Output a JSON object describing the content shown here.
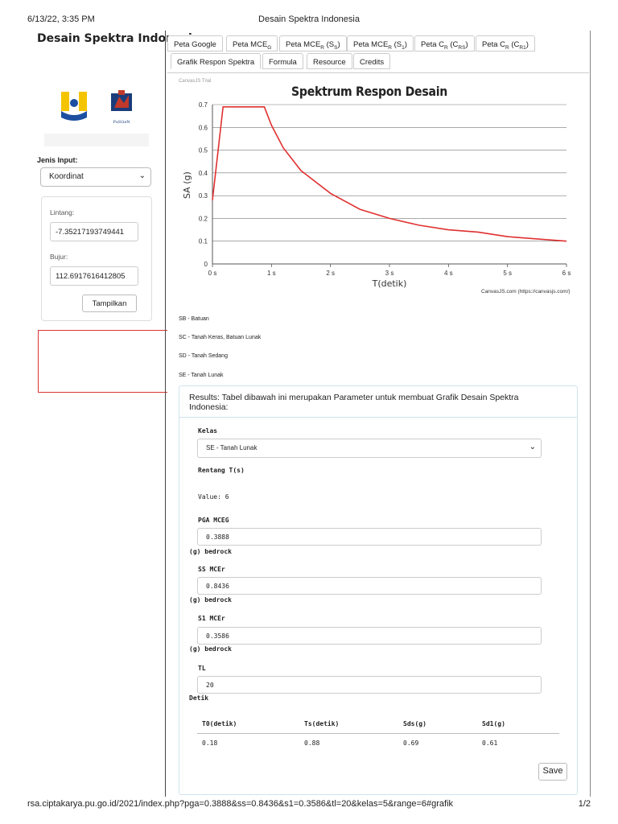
{
  "print": {
    "date": "6/13/22, 3:35 PM",
    "title": "Desain Spektra Indonesia",
    "url": "rsa.ciptakarya.pu.go.id/2021/index.php?pga=0.3888&ss=0.8436&s1=0.3586&tl=20&kelas=5&range=6#grafik",
    "page": "1/2"
  },
  "sidebar": {
    "title": "Desain Spektra Indonesia",
    "logo_pu": "pu-logo",
    "logo_pusgen": "PuSGeN",
    "jenis_label": "Jenis Input:",
    "jenis_value": "Koordinat",
    "lintang_label": "Lintang:",
    "lintang_value": "-7.35217193749441",
    "bujur_label": "Bujur:",
    "bujur_value": "112.6917616412805",
    "tampilkan_label": "Tampilkan"
  },
  "tabs": {
    "row1": [
      {
        "label": "Peta Google"
      },
      {
        "label": "Peta MCE",
        "sub": "G"
      },
      {
        "label": "Peta MCE",
        "sub": "R",
        "suffix": " (S",
        "sub2": "S",
        "end": ")"
      },
      {
        "label": "Peta MCE",
        "sub": "R",
        "suffix": " (S",
        "sub2": "1",
        "end": ")"
      },
      {
        "label": "Peta C",
        "sub": "R",
        "suffix": " (C",
        "sub2": "RS",
        "end": ")"
      },
      {
        "label": "Peta C",
        "sub": "R",
        "suffix": " (C",
        "sub2": "R1",
        "end": ")"
      }
    ],
    "row2": [
      {
        "label": "Grafik Respon Spektra"
      },
      {
        "label": "Formula"
      },
      {
        "label": "Resource"
      },
      {
        "label": "Credits"
      }
    ]
  },
  "chart_meta": {
    "trial": "CanvasJS Trial",
    "credit": "CanvasJS.com (https://canvasjs.com/)"
  },
  "chart_data": {
    "type": "line",
    "title": "Spektrum Respon Desain",
    "xlabel": "T(detik)",
    "ylabel": "SA (g)",
    "xlim": [
      0,
      6
    ],
    "ylim": [
      0,
      0.7
    ],
    "x_ticks": [
      "0 s",
      "1 s",
      "2 s",
      "3 s",
      "4 s",
      "5 s",
      "6 s"
    ],
    "y_ticks": [
      "0",
      "0.1",
      "0.2",
      "0.3",
      "0.4",
      "0.5",
      "0.6",
      "0.7"
    ],
    "grid": true,
    "series": [
      {
        "color": "#e03030",
        "x": [
          0,
          0.18,
          0.88,
          1.0,
          1.2,
          1.5,
          2.0,
          2.5,
          3.0,
          3.5,
          4.0,
          4.5,
          5.0,
          5.5,
          6.0
        ],
        "y": [
          0.28,
          0.69,
          0.69,
          0.61,
          0.51,
          0.41,
          0.31,
          0.24,
          0.2,
          0.17,
          0.15,
          0.14,
          0.12,
          0.11,
          0.1
        ]
      }
    ]
  },
  "legend": {
    "items": [
      "SB - Batuan",
      "SC - Tanah Keras, Batuan Lunak",
      "SD - Tanah Sedang",
      "SE - Tanah Lunak"
    ]
  },
  "results": {
    "heading": "Results: Tabel dibawah ini merupakan Parameter untuk membuat Grafik Desain Spektra Indonesia:",
    "kelas_label": "Kelas",
    "kelas_value": "SE - Tanah Lunak",
    "rentang_label": "Rentang T(s)",
    "rentang_value": "Value: 6",
    "pga_label": "PGA MCEG",
    "pga_value": "0.3888",
    "pga_unit": "(g) bedrock",
    "ss_label": "SS MCEr",
    "ss_value": "0.8436",
    "ss_unit": "(g) bedrock",
    "s1_label": "S1 MCEr",
    "s1_value": "0.3586",
    "s1_unit": "(g) bedrock",
    "tl_label": "TL",
    "tl_value": "20",
    "tl_unit": "Detik",
    "table": {
      "headers": [
        "T0(detik)",
        "Ts(detik)",
        "Sds(g)",
        "Sd1(g)"
      ],
      "row": [
        "0.18",
        "0.88",
        "0.69",
        "0.61"
      ]
    },
    "save_label": "Save"
  }
}
